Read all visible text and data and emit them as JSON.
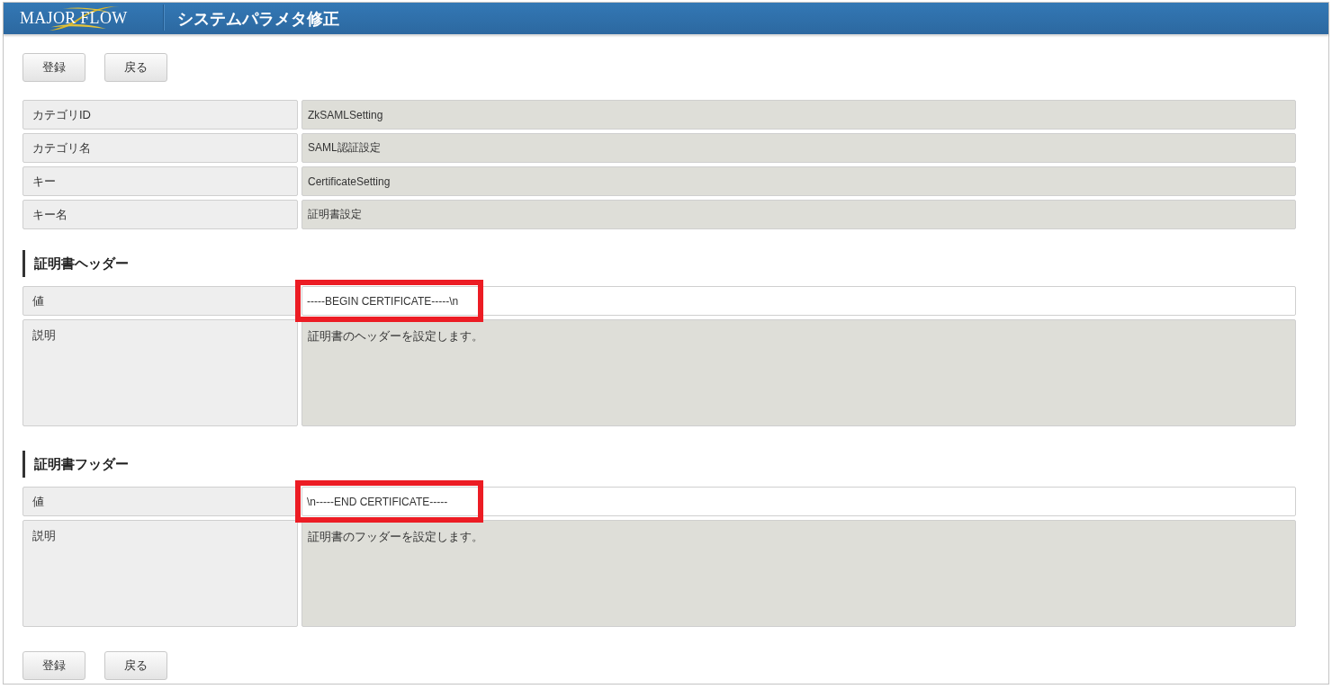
{
  "header": {
    "logo": "MAJOR FLOW",
    "title": "システムパラメタ修正"
  },
  "top_buttons": [
    "登録",
    "戻る"
  ],
  "info_rows": [
    {
      "label": "カテゴリID",
      "value": "ZkSAMLSetting"
    },
    {
      "label": "カテゴリ名",
      "value": "SAML認証設定"
    },
    {
      "label": "キー",
      "value": "CertificateSetting"
    },
    {
      "label": "キー名",
      "value": "証明書設定"
    }
  ],
  "sections": [
    {
      "title": "証明書ヘッダー",
      "value": {
        "label": "値",
        "text": "-----BEGIN CERTIFICATE-----\\n",
        "highlighted": true
      },
      "description": {
        "label": "説明",
        "text": "証明書のヘッダーを設定します。"
      }
    },
    {
      "title": "証明書フッダー",
      "value": {
        "label": "値",
        "text": "\\n-----END CERTIFICATE-----",
        "highlighted": true
      },
      "description": {
        "label": "説明",
        "text": "証明書のフッダーを設定します。"
      }
    }
  ],
  "bottom_buttons": [
    "登録",
    "戻る"
  ]
}
